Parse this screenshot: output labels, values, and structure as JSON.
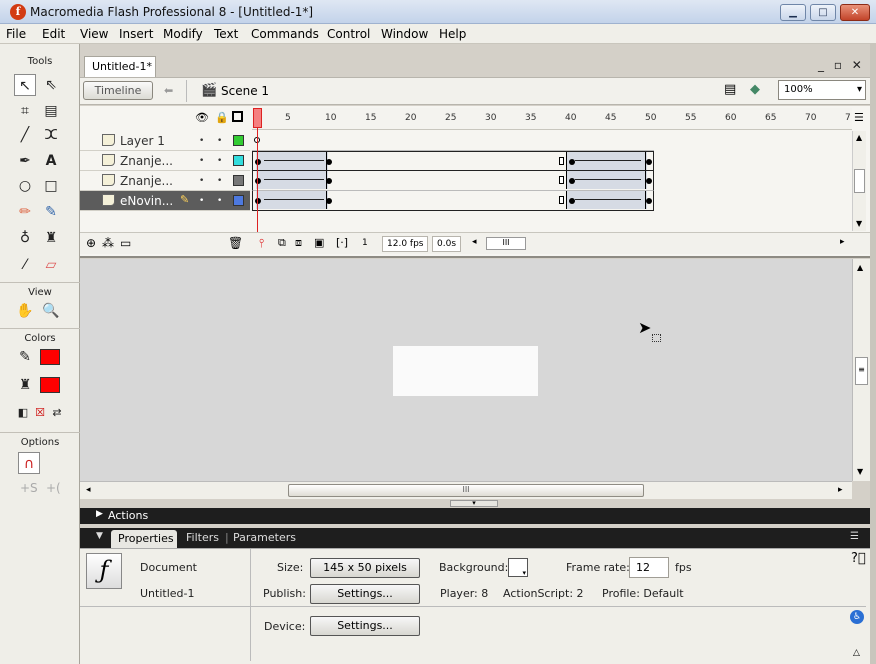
{
  "window": {
    "title": "Macromedia Flash Professional 8 - [Untitled-1*]",
    "app_icon": "flash-logo"
  },
  "menu": [
    "File",
    "Edit",
    "View",
    "Insert",
    "Modify",
    "Text",
    "Commands",
    "Control",
    "Window",
    "Help"
  ],
  "tools": {
    "title": "Tools",
    "view_label": "View",
    "colors_label": "Colors",
    "options_label": "Options"
  },
  "document": {
    "tab": "Untitled-1*"
  },
  "editbar": {
    "timeline_button": "Timeline",
    "scene": "Scene 1",
    "zoom": "100%"
  },
  "timeline": {
    "ruler": [
      "1",
      "5",
      "10",
      "15",
      "20",
      "25",
      "30",
      "35",
      "40",
      "45",
      "50",
      "55",
      "60",
      "65",
      "70",
      "7"
    ],
    "layers": [
      {
        "name": "Layer 1",
        "color": "#33cc33"
      },
      {
        "name": "Znanje...",
        "color": "#33dddd"
      },
      {
        "name": "Znanje...",
        "color": "#777777"
      },
      {
        "name": "eNovin...",
        "color": "#4d79e0"
      }
    ],
    "current_frame": "1",
    "frame_rate": "12.0 fps",
    "elapsed": "0.0s"
  },
  "panels": {
    "actions": "Actions",
    "tabs": [
      "Properties",
      "Filters",
      "Parameters"
    ]
  },
  "properties": {
    "doc_type": "Document",
    "doc_name": "Untitled-1",
    "size_label": "Size:",
    "size_value": "145 x 50 pixels",
    "background_label": "Background:",
    "framerate_label": "Frame rate:",
    "framerate_value": "12",
    "fps_label": "fps",
    "publish_label": "Publish:",
    "settings_label": "Settings...",
    "player": "Player: 8",
    "actionscript": "ActionScript: 2",
    "profile": "Profile: Default",
    "device_label": "Device:",
    "device_settings": "Settings..."
  }
}
